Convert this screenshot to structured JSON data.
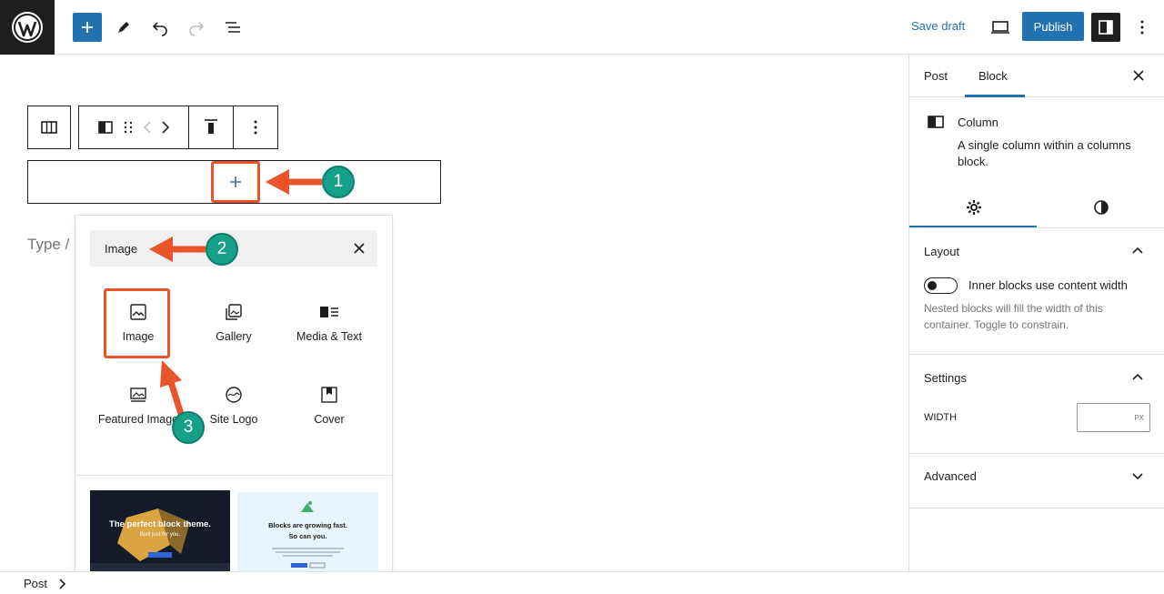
{
  "topbar": {
    "save_draft": "Save draft",
    "publish": "Publish",
    "icons": [
      "wordpress-logo",
      "plus-icon",
      "pen-icon",
      "undo-icon",
      "redo-icon",
      "list-view-icon",
      "desktop-preview-icon",
      "sidebar-settings-icon",
      "kebab-menu-icon"
    ]
  },
  "canvas": {
    "type_hint": "Type /"
  },
  "inserter": {
    "search_value": "Image",
    "blocks": [
      {
        "label": "Image",
        "icon": "image-icon"
      },
      {
        "label": "Gallery",
        "icon": "gallery-icon"
      },
      {
        "label": "Media & Text",
        "icon": "media-text-icon"
      },
      {
        "label": "Featured Image",
        "icon": "featured-image-icon"
      },
      {
        "label": "Site Logo",
        "icon": "site-logo-icon"
      },
      {
        "label": "Cover",
        "icon": "cover-icon"
      }
    ],
    "patterns": [
      {
        "title": "The perfect block theme.",
        "subtitle": "Built just for you."
      },
      {
        "title": "Blocks are growing fast.",
        "subtitle": "So can you."
      }
    ]
  },
  "sidebar": {
    "tabs": [
      "Post",
      "Block"
    ],
    "active_tab": "Block",
    "block_title": "Column",
    "block_desc": "A single column within a columns block.",
    "layout": {
      "title": "Layout",
      "toggle_label": "Inner blocks use content width",
      "help": "Nested blocks will fill the width of this container. Toggle to constrain."
    },
    "settings": {
      "title": "Settings",
      "width_label": "WIDTH",
      "width_unit": "PX"
    },
    "advanced": {
      "title": "Advanced"
    }
  },
  "footer": {
    "breadcrumb": "Post"
  },
  "annotations": {
    "step1": "1",
    "step2": "2",
    "step3": "3"
  },
  "colors": {
    "accent": "#2271b1",
    "highlight": "#e9542a",
    "badge": "#17a088"
  }
}
